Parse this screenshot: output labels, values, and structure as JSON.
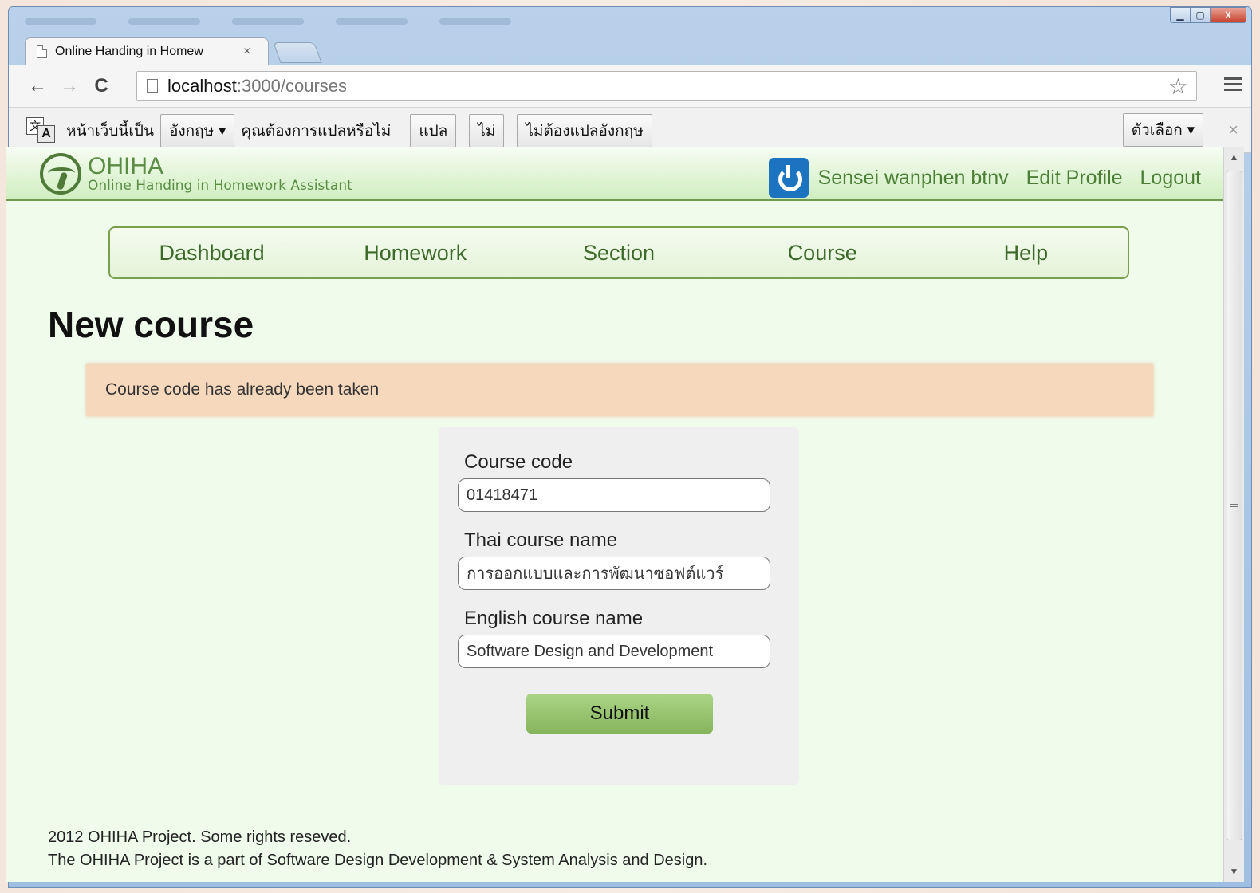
{
  "browser": {
    "tab_title": "Online Handing in Homew",
    "tab_close": "×",
    "url_host": "localhost",
    "url_path": ":3000/courses",
    "back_glyph": "←",
    "forward_glyph": "→",
    "reload_glyph": "C",
    "star_glyph": "☆",
    "window_min": "▁",
    "window_max": "▢",
    "window_close": "X"
  },
  "translate_bar": {
    "icon_char_1": "文",
    "icon_char_2": "A",
    "page_is_in": "หน้าเว็บนี้เป็น",
    "language": "อังกฤษ",
    "question": "คุณต้องการแปลหรือไม่",
    "translate_button": "แปล",
    "no_button": "ไม่",
    "never_button": "ไม่ต้องแปลอังกฤษ",
    "options_button": "ตัวเลือก",
    "close": "×",
    "caret": "▼"
  },
  "site": {
    "logo_name": "OHIHA",
    "logo_tagline": "Online Handing in Homework Assistant",
    "user_name": "Sensei wanphen btnv",
    "edit_profile": "Edit Profile",
    "logout": "Logout"
  },
  "nav": {
    "items": [
      "Dashboard",
      "Homework",
      "Section",
      "Course",
      "Help"
    ]
  },
  "page": {
    "title": "New course",
    "alert": "Course code has already been taken"
  },
  "form": {
    "course_code_label": "Course code",
    "course_code_value": "01418471",
    "thai_name_label": "Thai course name",
    "thai_name_value": "การออกแบบและการพัฒนาซอฟต์แวร์",
    "english_name_label": "English course name",
    "english_name_value": "Software Design and Development",
    "submit": "Submit"
  },
  "footer": {
    "line1": "2012 OHIHA Project. Some rights reseved.",
    "line2": "The OHIHA Project is a part of Software Design Development & System Analysis and Design."
  },
  "colors": {
    "page_bg": "#effbeb",
    "accent_green": "#4c7f35",
    "alert_bg": "#f6d8bd",
    "submit_green": "#98c46f",
    "power_blue": "#1c73bf"
  }
}
